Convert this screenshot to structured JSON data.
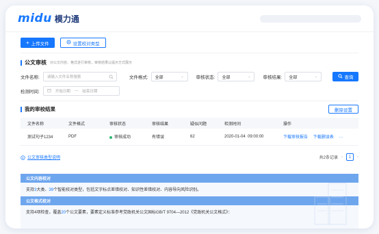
{
  "brand": {
    "logo_text": "midu",
    "name": "模力通"
  },
  "toolbar": {
    "upload_label": "上传文件",
    "settings_label": "设置校对类型"
  },
  "review": {
    "title": "公文审核",
    "hint": "对公文内容、格式进行审核，审核结果以提示方式展示"
  },
  "filters": {
    "filename_label": "文件名称:",
    "filename_placeholder": "请输入文件名称搜索",
    "format_label": "文件格式:",
    "format_value": "全部",
    "status_label": "审核状态:",
    "status_value": "全部",
    "result_label": "审核结果:",
    "result_value": "全部",
    "query_label": "查询",
    "time_label": "检测时间:",
    "start_placeholder": "开始日期",
    "range_sep": "—",
    "end_placeholder": "结束日期"
  },
  "results": {
    "title": "我的审校结果",
    "delete_label": "删除设置",
    "columns": [
      "文件名称",
      "文件格式",
      "审核状态",
      "审核结果",
      "疑似问题",
      "检测时间",
      "操作"
    ],
    "rows": [
      {
        "name": "测试句子1234",
        "format": "PDF",
        "status": "审核成功",
        "result": "有错误",
        "issues": "62",
        "time": "2020-01-04  09:00:00",
        "action1": "下载审核报告",
        "action2": "下载删误表",
        "more": "···"
      }
    ],
    "status_color": "#2eb872"
  },
  "footer": {
    "help_link": "公文审核类型说明",
    "total": "共2条记录",
    "page": "1",
    "prev": "‹",
    "next": "›"
  },
  "notice": {
    "content_title": "公文内容校对",
    "content_text_a": "支持",
    "content_num1": "3",
    "content_text_b": "大类、",
    "content_num2": "39",
    "content_text_c": "个智能校对类型，包括文字标点差错校对、知识性差错校对、内容导向风险识别。",
    "format_title": "公文格式校对",
    "format_text_a": "支持4项检查，覆盖",
    "format_num": "20",
    "format_text_b": "个公文要素，要素定义标准参考党政机关公文国标GB/T 9704—2012《党政机关公文格式》："
  },
  "colors": {
    "accent": "#1677ff",
    "band": "#6ea6ee"
  }
}
